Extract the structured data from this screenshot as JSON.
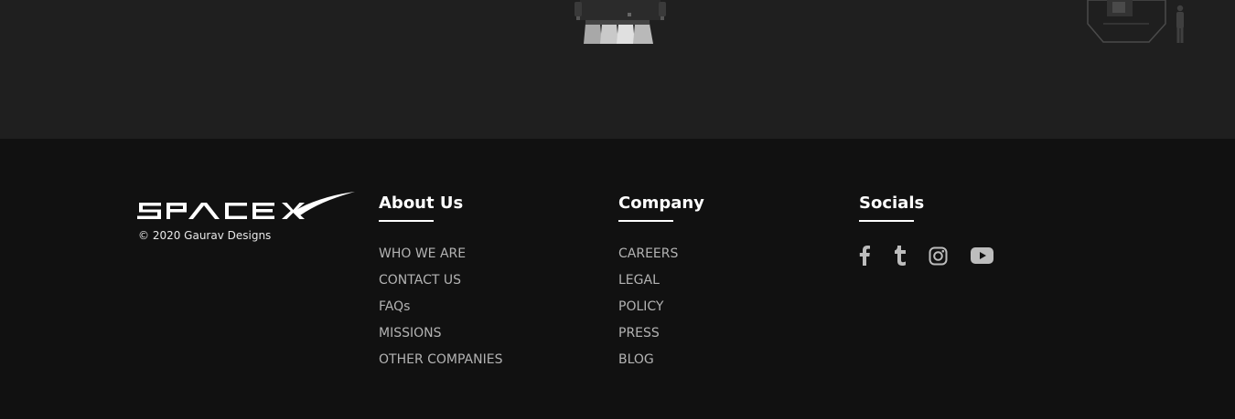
{
  "brand": {
    "logo_text": "SPACEX",
    "copyright": "© 2020 Gaurav Designs"
  },
  "about": {
    "heading": "About Us",
    "links": [
      "WHO WE ARE",
      "CONTACT US",
      "FAQs",
      "MISSIONS",
      "OTHER COMPANIES"
    ]
  },
  "company": {
    "heading": "Company",
    "links": [
      "CAREERS",
      "LEGAL",
      "POLICY",
      "PRESS",
      "BLOG"
    ]
  },
  "socials": {
    "heading": "Socials",
    "icons": [
      "facebook-icon",
      "tumblr-icon",
      "instagram-icon",
      "youtube-icon"
    ]
  },
  "colors": {
    "hero_bg": "#1f1f1f",
    "footer_bg": "#111111",
    "heading": "#ffffff",
    "link": "#b3b3b3",
    "icon": "#bdbdbd"
  }
}
